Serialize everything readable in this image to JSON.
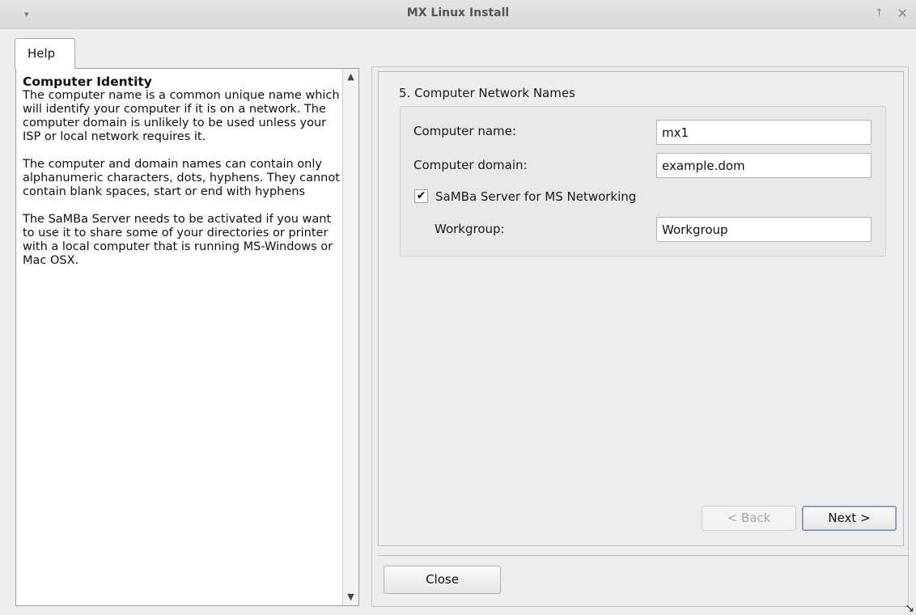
{
  "window": {
    "title": "MX Linux Install",
    "menu_icon": "▾",
    "pin_icon": "↑",
    "close_icon": "✕"
  },
  "tabs": [
    {
      "label": "Help"
    }
  ],
  "help": {
    "heading": "Computer Identity",
    "paragraphs": [
      "The computer name is a common unique name which will identify your computer if it is on a network. The computer domain is unlikely to be used unless your ISP or local network requires it.",
      "The computer and domain names can contain only alphanumeric characters, dots, hyphens. They cannot contain blank spaces, start or end with hyphens",
      "The SaMBa Server needs to be activated if you want to use it to share some of your directories or printer with a local computer that is running MS-Windows or Mac OSX."
    ]
  },
  "section": {
    "title": "5. Computer Network Names",
    "computer_name_label": "Computer name:",
    "computer_name_value": "mx1",
    "computer_domain_label": "Computer domain:",
    "computer_domain_value": "example.dom",
    "samba_checkbox_label": "SaMBa Server for MS Networking",
    "samba_checked": true,
    "samba_check_glyph": "✔",
    "workgroup_label": "Workgroup:",
    "workgroup_value": "Workgroup"
  },
  "buttons": {
    "back": "< Back",
    "next": "Next >",
    "close": "Close"
  },
  "colors": {
    "window_bg": "#ededed",
    "focus_border": "#6a8fb8"
  }
}
